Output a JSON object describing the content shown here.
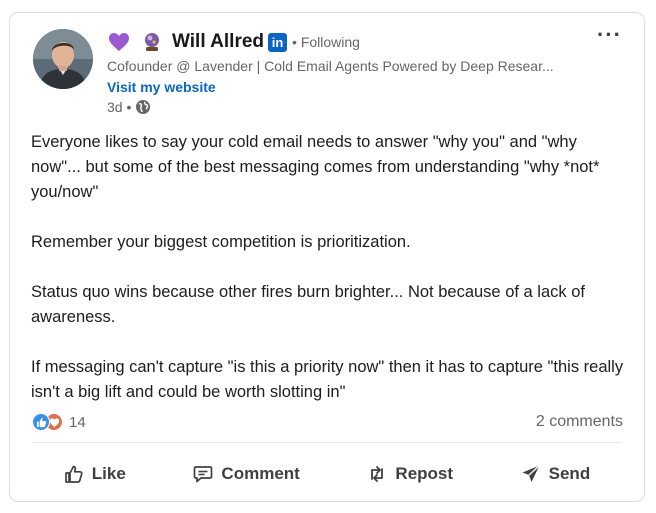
{
  "post": {
    "author": {
      "name": "Will Allred",
      "connection_status": "• Following",
      "headline": "Cofounder @ Lavender | Cold Email Agents Powered by Deep Resear...",
      "link_label": "Visit my website",
      "posted_ago": "3d •",
      "badges": [
        "purple-heart-icon",
        "crystal-ball-emoji-icon",
        "linkedin-icon"
      ],
      "linkedin_label": "in"
    },
    "more_label": "···",
    "paragraphs": [
      "Everyone likes to say your cold email needs to answer \"why you\" and \"why now\"... but some of the best messaging comes from understanding \"why *not* you/now\"",
      "Remember your biggest competition is prioritization.",
      "Status quo wins because other fires burn brighter... Not because of a lack of awareness.",
      "If messaging can't capture \"is this a priority now\" then it has to capture \"this really isn't a big lift and could be worth slotting in\""
    ],
    "stats": {
      "reaction_count": "14",
      "reaction_types": [
        "like",
        "love"
      ],
      "comments_label": "2 comments"
    },
    "actions": {
      "like": "Like",
      "comment": "Comment",
      "repost": "Repost",
      "send": "Send"
    }
  },
  "colors": {
    "link": "#0a66c2",
    "like_reaction": "#378fe9",
    "love_reaction": "#df704d",
    "heart": "#9b59d0"
  }
}
